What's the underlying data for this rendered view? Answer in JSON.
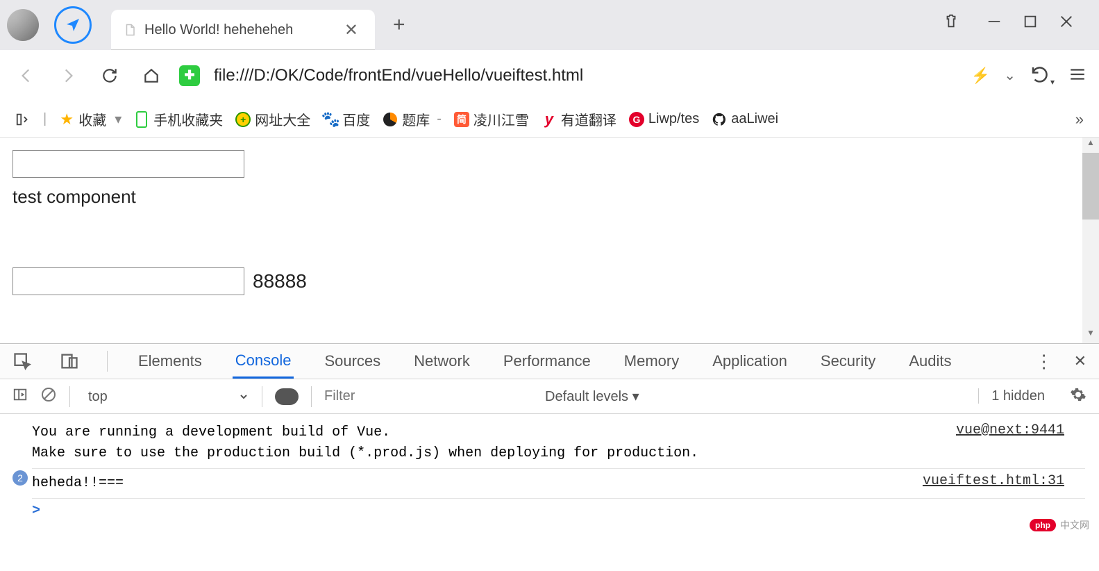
{
  "titlebar": {
    "tab_title": "Hello World! heheheheh",
    "new_tab": "+",
    "close": "✕"
  },
  "addressbar": {
    "url": "file:///D:/OK/Code/frontEnd/vueHello/vueiftest.html"
  },
  "bookmarks": {
    "fav": "收藏",
    "mobile": "手机收藏夹",
    "wangzhi": "网址大全",
    "baidu": "百度",
    "tiku": "题库",
    "lingchuan": "凌川江雪",
    "youdao": "有道翻译",
    "liwp": "Liwp/tes",
    "aaliwei": "aaLiwei",
    "more": "»",
    "dash": "-",
    "jian": "简",
    "liwp_g": "G",
    "plus360": "+",
    "youd_y": "y"
  },
  "page": {
    "text1": "test component",
    "text2": "88888"
  },
  "devtools": {
    "tabs": {
      "elements": "Elements",
      "console": "Console",
      "sources": "Sources",
      "network": "Network",
      "performance": "Performance",
      "memory": "Memory",
      "application": "Application",
      "security": "Security",
      "audits": "Audits"
    },
    "more": "⋮",
    "close": "✕"
  },
  "console_toolbar": {
    "context": "top",
    "filter_placeholder": "Filter",
    "levels": "Default levels ▾",
    "hidden": "1 hidden"
  },
  "console": {
    "msg1_l1": "You are running a development build of Vue.",
    "msg1_l2": "Make sure to use the production build (*.prod.js) when deploying for production.",
    "src1": "vue@next:9441",
    "badge": "2",
    "msg2": "heheda!!===",
    "src2": "vueiftest.html:31",
    "prompt": ">"
  },
  "watermark": {
    "pill": "php",
    "text": "中文网"
  }
}
